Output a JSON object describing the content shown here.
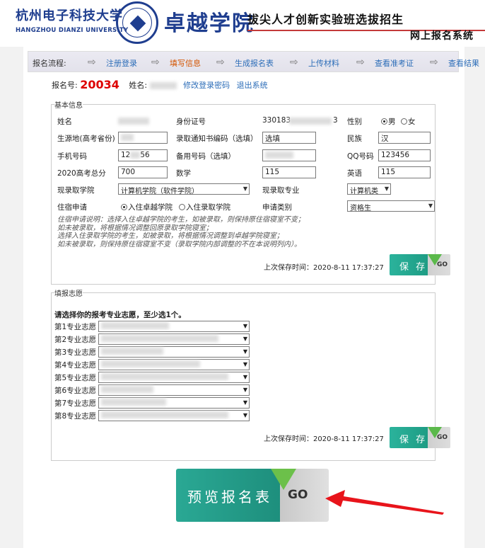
{
  "header": {
    "school_name": "杭州电子科技大学",
    "school_name_en": "HANGZHOU DIANZI UNIVERSITY",
    "college_name": "卓越学院",
    "banner_title": "拔尖人才创新实验班选拔招生",
    "banner_sub": "网上报名系统"
  },
  "flow": {
    "label": "报名流程:",
    "steps": [
      "注册登录",
      "填写信息",
      "生成报名表",
      "上传材料",
      "查看准考证",
      "查看结果"
    ],
    "current_color": "#d35400"
  },
  "reg": {
    "number_label": "报名号:",
    "number": "20034",
    "name_label": "姓名:",
    "change_password": "修改登录密码",
    "logout": "退出系统"
  },
  "basic": {
    "legend": "基本信息",
    "name_label": "姓名",
    "id_label": "身份证号",
    "id_prefix": "330183",
    "id_suffix": "3",
    "gender_label": "性别",
    "male": "男",
    "female": "女",
    "origin_label": "生源地(高考省份)",
    "notice_label": "录取通知书编码（选填）",
    "notice_value": "选填",
    "nation_label": "民族",
    "nation_value": "汉",
    "phone_label": "手机号码",
    "phone_value": "12",
    "phone_suffix": "56",
    "backup_label": "备用号码（选填）",
    "qq_label": "QQ号码",
    "qq_value": "123456",
    "score_label": "2020高考总分",
    "score_value": "700",
    "math_label": "数学",
    "math_value": "115",
    "english_label": "英语",
    "english_value": "115",
    "college_label": "现录取学院",
    "college_value": "计算机学院（软件学院）",
    "major_label": "现录取专业",
    "major_value": "计算机类",
    "dorm_label": "住宿申请",
    "dorm_opt1": "入住卓越学院",
    "dorm_opt2": "入住录取学院",
    "apply_type_label": "申请类别",
    "apply_type_value": "资格生",
    "note": "住宿申请说明：选择入住卓越学院的考生，如被录取，则保持原住宿寝室不变；\n如未被录取，将根据情况调整回原录取学院寝室；\n选择入住录取学院的考生，如被录取，将根据情况调整到卓越学院寝室；\n如未被录取，则保持原住宿寝室不变（录取学院内部调整的不在本说明列内）。",
    "saved_time": "上次保存时间：2020-8-11 17:37:27",
    "save_label": "保 存",
    "go": "GO"
  },
  "zhiyuan": {
    "legend": "填报志愿",
    "instruction": "请选择你的报考专业志愿，至少选1个。",
    "items": [
      {
        "label": "第1专业志愿"
      },
      {
        "label": "第2专业志愿"
      },
      {
        "label": "第3专业志愿"
      },
      {
        "label": "第4专业志愿"
      },
      {
        "label": "第5专业志愿"
      },
      {
        "label": "第6专业志愿"
      },
      {
        "label": "第7专业志愿"
      },
      {
        "label": "第8专业志愿"
      }
    ],
    "saved_time": "上次保存时间：2020-8-11 17:37:27",
    "save_label": "保 存",
    "go": "GO"
  },
  "preview": {
    "label": "预览报名表",
    "go": "GO"
  },
  "colors": {
    "brand_blue": "#1f3e8f",
    "accent_green": "#1e9c84",
    "link": "#2c6db8",
    "reg_number": "#dd0000",
    "arrow": "#e8141b"
  }
}
